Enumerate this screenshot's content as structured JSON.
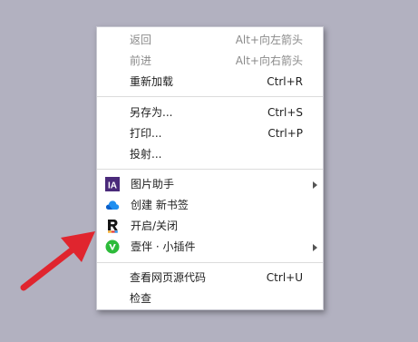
{
  "context_menu": {
    "items": [
      {
        "label": "返回",
        "shortcut": "Alt+向左箭头",
        "disabled": true
      },
      {
        "label": "前进",
        "shortcut": "Alt+向右箭头",
        "disabled": true
      },
      {
        "label": "重新加载",
        "shortcut": "Ctrl+R"
      },
      {
        "label": "另存为...",
        "shortcut": "Ctrl+S"
      },
      {
        "label": "打印...",
        "shortcut": "Ctrl+P"
      },
      {
        "label": "投射..."
      },
      {
        "label": "图片助手",
        "icon": "image-assistant-icon",
        "submenu": true
      },
      {
        "label": "创建 新书签",
        "icon": "cloud-bookmark-icon"
      },
      {
        "label": "开启/关闭",
        "icon": "extension-r-icon"
      },
      {
        "label": "壹伴 · 小插件",
        "icon": "yiban-icon",
        "submenu": true
      },
      {
        "label": "查看网页源代码",
        "shortcut": "Ctrl+U"
      },
      {
        "label": "检查"
      }
    ]
  },
  "colors": {
    "background": "#b2b1c0",
    "menu_bg": "#ffffff",
    "annotation_arrow": "#e0252e",
    "ia_icon": "#4a2a7a",
    "yiban_icon": "#2dbb3a"
  }
}
